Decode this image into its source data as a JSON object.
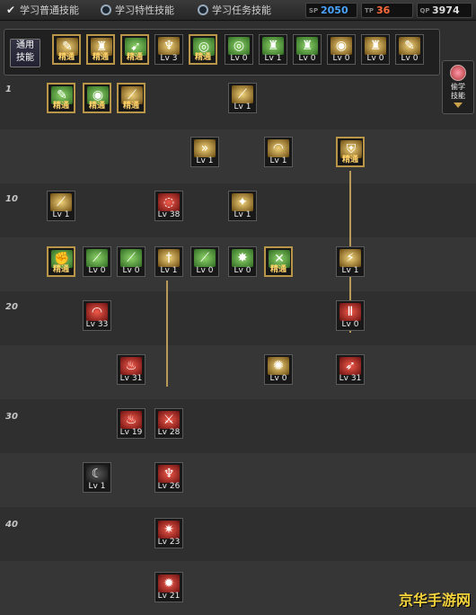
{
  "tabs": [
    {
      "label": "学习普通技能",
      "icon": "check-icon"
    },
    {
      "label": "学习特性技能",
      "icon": "radio-icon"
    },
    {
      "label": "学习任务技能",
      "icon": "radio-icon"
    }
  ],
  "points": [
    {
      "tag": "SP",
      "value": "2050",
      "color": "#4aa3ff"
    },
    {
      "tag": "TP",
      "value": "36",
      "color": "#ff6a3a"
    },
    {
      "tag": "QP",
      "value": "3974",
      "color": "#dddddd"
    }
  ],
  "common": {
    "label_line1": "通用",
    "label_line2": "技能"
  },
  "side_panel": {
    "line1": "偷学",
    "line2": "技能"
  },
  "levels": [
    "1",
    "10",
    "20",
    "30",
    "40"
  ],
  "common_skills": [
    {
      "cap": "精通",
      "color": "y",
      "gold": true,
      "icon": "scroll-icon"
    },
    {
      "cap": "精通",
      "color": "y",
      "gold": true,
      "icon": "figure-icon"
    },
    {
      "cap": "精通",
      "color": "g",
      "gold": true,
      "icon": "runner-icon"
    },
    {
      "cap": "Lv 3",
      "color": "y",
      "gold": false,
      "icon": "wings-icon"
    },
    {
      "cap": "精通",
      "color": "g",
      "gold": true,
      "icon": "target-icon"
    },
    {
      "cap": "Lv 0",
      "color": "g",
      "gold": false,
      "icon": "target-icon"
    },
    {
      "cap": "Lv 1",
      "color": "g",
      "gold": false,
      "icon": "figure-icon"
    },
    {
      "cap": "Lv 0",
      "color": "g",
      "gold": false,
      "icon": "figure-icon"
    },
    {
      "cap": "Lv 0",
      "color": "y",
      "gold": false,
      "icon": "eye-icon"
    },
    {
      "cap": "Lv 0",
      "color": "y",
      "gold": false,
      "icon": "figure-icon"
    },
    {
      "cap": "Lv 0",
      "color": "y",
      "gold": false,
      "icon": "scroll-icon"
    }
  ],
  "tree_skills": [
    {
      "cap": "精通",
      "color": "g",
      "gold": true,
      "icon": "scroll-icon"
    },
    {
      "cap": "精通",
      "color": "g",
      "gold": true,
      "icon": "eye-icon"
    },
    {
      "cap": "精通",
      "color": "y",
      "gold": true,
      "icon": "claw-icon"
    },
    {
      "cap": "Lv 1",
      "color": "y",
      "gold": false,
      "icon": "slash-icon"
    },
    {
      "cap": "Lv 1",
      "color": "y",
      "gold": false,
      "icon": "arrows-icon"
    },
    {
      "cap": "Lv 1",
      "color": "y",
      "gold": false,
      "icon": "swoosh-icon"
    },
    {
      "cap": "精通",
      "color": "y",
      "gold": true,
      "icon": "shield-icon"
    },
    {
      "cap": "Lv 1",
      "color": "y",
      "gold": false,
      "icon": "slash-icon"
    },
    {
      "cap": "Lv 38",
      "color": "r",
      "gold": false,
      "icon": "swirl-icon"
    },
    {
      "cap": "Lv 1",
      "color": "y",
      "gold": false,
      "icon": "sparkle-icon"
    },
    {
      "cap": "精通",
      "color": "g",
      "gold": true,
      "icon": "fist-icon"
    },
    {
      "cap": "Lv 0",
      "color": "g",
      "gold": false,
      "icon": "blade-icon"
    },
    {
      "cap": "Lv 0",
      "color": "g",
      "gold": false,
      "icon": "blade-icon"
    },
    {
      "cap": "Lv 1",
      "color": "y",
      "gold": false,
      "icon": "sword-icon"
    },
    {
      "cap": "Lv 0",
      "color": "g",
      "gold": false,
      "icon": "blade-icon"
    },
    {
      "cap": "Lv 0",
      "color": "g",
      "gold": false,
      "icon": "burst-icon"
    },
    {
      "cap": "精通",
      "color": "g",
      "gold": true,
      "icon": "cross-icon"
    },
    {
      "cap": "Lv 1",
      "color": "y",
      "gold": false,
      "icon": "strike-icon"
    },
    {
      "cap": "Lv 33",
      "color": "r",
      "gold": false,
      "icon": "swoosh-icon"
    },
    {
      "cap": "Lv 0",
      "color": "r",
      "gold": false,
      "icon": "pillar-icon"
    },
    {
      "cap": "Lv 31",
      "color": "r",
      "gold": false,
      "icon": "flame-icon"
    },
    {
      "cap": "Lv 0",
      "color": "y",
      "gold": false,
      "icon": "explosion-icon"
    },
    {
      "cap": "Lv 31",
      "color": "r",
      "gold": false,
      "icon": "stab-icon"
    },
    {
      "cap": "Lv 19",
      "color": "r",
      "gold": false,
      "icon": "flame-icon"
    },
    {
      "cap": "Lv 28",
      "color": "r",
      "gold": false,
      "icon": "swords-icon"
    },
    {
      "cap": "Lv 1",
      "color": "k",
      "gold": false,
      "icon": "moon-icon"
    },
    {
      "cap": "Lv 26",
      "color": "r",
      "gold": false,
      "icon": "phoenix-icon"
    },
    {
      "cap": "Lv 23",
      "color": "r",
      "gold": false,
      "icon": "star-icon"
    },
    {
      "cap": "Lv 21",
      "color": "r",
      "gold": false,
      "icon": "blast-icon"
    }
  ],
  "watermark": "京华手游网"
}
